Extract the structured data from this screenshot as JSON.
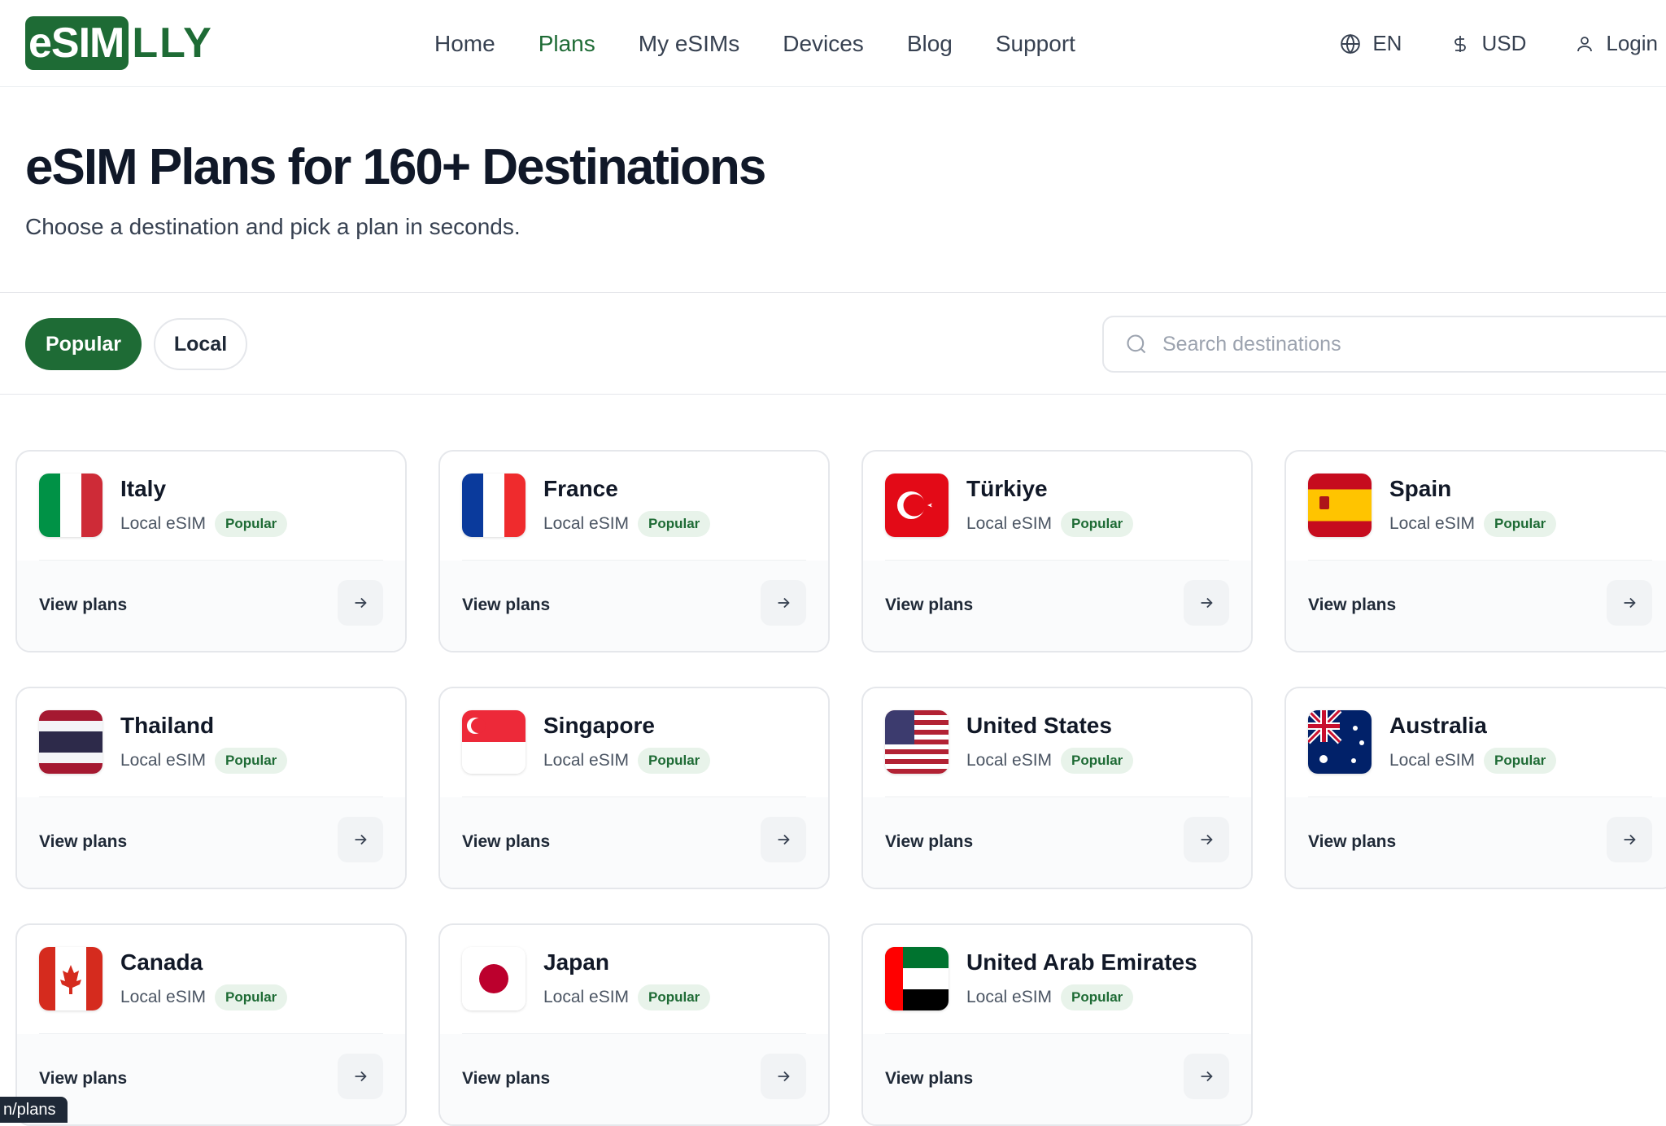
{
  "brand": {
    "logo_box": "eSIM",
    "logo_rest": "LLY"
  },
  "nav": [
    {
      "label": "Home",
      "active": false
    },
    {
      "label": "Plans",
      "active": true
    },
    {
      "label": "My eSIMs",
      "active": false
    },
    {
      "label": "Devices",
      "active": false
    },
    {
      "label": "Blog",
      "active": false
    },
    {
      "label": "Support",
      "active": false
    }
  ],
  "header_right": {
    "language": "EN",
    "currency": "USD",
    "login": "Login"
  },
  "hero": {
    "title": "eSIM Plans for 160+ Destinations",
    "subtitle": "Choose a destination and pick a plan in seconds."
  },
  "filters": {
    "popular": "Popular",
    "local": "Local",
    "active": "Popular"
  },
  "search": {
    "placeholder": "Search destinations",
    "value": ""
  },
  "card_labels": {
    "type": "Local eSIM",
    "badge": "Popular",
    "cta": "View plans"
  },
  "destinations": [
    {
      "name": "Italy",
      "flag": "it"
    },
    {
      "name": "France",
      "flag": "fr"
    },
    {
      "name": "Türkiye",
      "flag": "tr"
    },
    {
      "name": "Spain",
      "flag": "es"
    },
    {
      "name": "Thailand",
      "flag": "th"
    },
    {
      "name": "Singapore",
      "flag": "sg"
    },
    {
      "name": "United States",
      "flag": "us"
    },
    {
      "name": "Australia",
      "flag": "au"
    },
    {
      "name": "Canada",
      "flag": "ca"
    },
    {
      "name": "Japan",
      "flag": "jp"
    },
    {
      "name": "United Arab Emirates",
      "flag": "ae"
    }
  ],
  "status_tooltip": "n/plans",
  "colors": {
    "brand": "#1e6b35",
    "badge_bg": "#e8f3ea",
    "text": "#111827"
  }
}
